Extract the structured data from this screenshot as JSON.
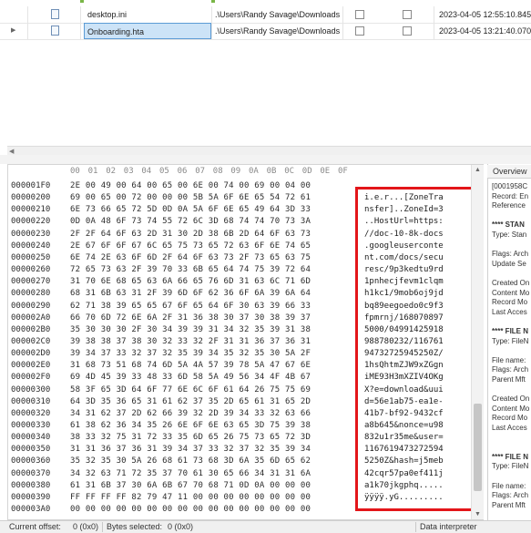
{
  "file_grid": {
    "rows": [
      {
        "name": "desktop.ini",
        "path": ".\\Users\\Randy Savage\\Downloads",
        "date": "2023-04-05 12:55:10.845",
        "selected": false,
        "current": false
      },
      {
        "name": "Onboarding.hta",
        "path": ".\\Users\\Randy Savage\\Downloads",
        "date": "2023-04-05 13:21:40.070",
        "selected": true,
        "current": true
      }
    ]
  },
  "hex": {
    "header": [
      "00",
      "01",
      "02",
      "03",
      "04",
      "05",
      "06",
      "07",
      "08",
      "09",
      "0A",
      "0B",
      "0C",
      "0D",
      "0E",
      "0F"
    ],
    "rows": [
      {
        "offset": "000001F0",
        "bytes": "2E 00 49 00 64 00 65 00 6E 00 74 00 69 00 04 00",
        "ascii": ""
      },
      {
        "offset": "00000200",
        "bytes": "69 00 65 00 72 00 00 00 5B 5A 6F 6E 65 54 72 61",
        "ascii": "i.e.r...[ZoneTra"
      },
      {
        "offset": "00000210",
        "bytes": "6E 73 66 65 72 5D 0D 0A 5A 6F 6E 65 49 64 3D 33",
        "ascii": "nsfer]..ZoneId=3"
      },
      {
        "offset": "00000220",
        "bytes": "0D 0A 48 6F 73 74 55 72 6C 3D 68 74 74 70 73 3A",
        "ascii": "..HostUrl=https:"
      },
      {
        "offset": "00000230",
        "bytes": "2F 2F 64 6F 63 2D 31 30 2D 38 6B 2D 64 6F 63 73",
        "ascii": "//doc-10-8k-docs"
      },
      {
        "offset": "00000240",
        "bytes": "2E 67 6F 6F 67 6C 65 75 73 65 72 63 6F 6E 74 65",
        "ascii": ".googleuserconte"
      },
      {
        "offset": "00000250",
        "bytes": "6E 74 2E 63 6F 6D 2F 64 6F 63 73 2F 73 65 63 75",
        "ascii": "nt.com/docs/secu"
      },
      {
        "offset": "00000260",
        "bytes": "72 65 73 63 2F 39 70 33 6B 65 64 74 75 39 72 64",
        "ascii": "resc/9p3kedtu9rd"
      },
      {
        "offset": "00000270",
        "bytes": "31 70 6E 68 65 63 6A 66 65 76 6D 31 63 6C 71 6D",
        "ascii": "1pnhecjfevm1clqm"
      },
      {
        "offset": "00000280",
        "bytes": "68 31 6B 63 31 2F 39 6D 6F 62 36 6F 6A 39 6A 64",
        "ascii": "h1kc1/9mob6oj9jd"
      },
      {
        "offset": "00000290",
        "bytes": "62 71 38 39 65 65 67 6F 65 64 6F 30 63 39 66 33",
        "ascii": "bq89eegoedo0c9f3"
      },
      {
        "offset": "000002A0",
        "bytes": "66 70 6D 72 6E 6A 2F 31 36 38 30 37 30 38 39 37",
        "ascii": "fpmrnj/168070897"
      },
      {
        "offset": "000002B0",
        "bytes": "35 30 30 30 2F 30 34 39 39 31 34 32 35 39 31 38",
        "ascii": "5000/04991425918"
      },
      {
        "offset": "000002C0",
        "bytes": "39 38 38 37 38 30 32 33 32 2F 31 31 36 37 36 31",
        "ascii": "988780232/116761"
      },
      {
        "offset": "000002D0",
        "bytes": "39 34 37 33 32 37 32 35 39 34 35 32 35 30 5A 2F",
        "ascii": "94732725945250Z/"
      },
      {
        "offset": "000002E0",
        "bytes": "31 68 73 51 68 74 6D 5A 4A 57 39 78 5A 47 67 6E",
        "ascii": "1hsQhtmZJW9xZGgn"
      },
      {
        "offset": "000002F0",
        "bytes": "69 4D 45 39 33 48 33 6D 58 5A 49 56 34 4F 4B 67",
        "ascii": "iME93H3mXZIV4OKg"
      },
      {
        "offset": "00000300",
        "bytes": "58 3F 65 3D 64 6F 77 6E 6C 6F 61 64 26 75 75 69",
        "ascii": "X?e=download&uui"
      },
      {
        "offset": "00000310",
        "bytes": "64 3D 35 36 65 31 61 62 37 35 2D 65 61 31 65 2D",
        "ascii": "d=56e1ab75-ea1e-"
      },
      {
        "offset": "00000320",
        "bytes": "34 31 62 37 2D 62 66 39 32 2D 39 34 33 32 63 66",
        "ascii": "41b7-bf92-9432cf"
      },
      {
        "offset": "00000330",
        "bytes": "61 38 62 36 34 35 26 6E 6F 6E 63 65 3D 75 39 38",
        "ascii": "a8b645&nonce=u98"
      },
      {
        "offset": "00000340",
        "bytes": "38 33 32 75 31 72 33 35 6D 65 26 75 73 65 72 3D",
        "ascii": "832u1r35me&user="
      },
      {
        "offset": "00000350",
        "bytes": "31 31 36 37 36 31 39 34 37 33 32 37 32 35 39 34",
        "ascii": "1167619473272594"
      },
      {
        "offset": "00000360",
        "bytes": "35 32 35 30 5A 26 68 61 73 68 3D 6A 35 6D 65 62",
        "ascii": "5250Z&hash=j5meb"
      },
      {
        "offset": "00000370",
        "bytes": "34 32 63 71 72 35 37 70 61 30 65 66 34 31 31 6A",
        "ascii": "42cqr57pa0ef411j"
      },
      {
        "offset": "00000380",
        "bytes": "61 31 6B 37 30 6A 6B 67 70 68 71 0D 0A 00 00 00",
        "ascii": "a1k70jkgphq....."
      },
      {
        "offset": "00000390",
        "bytes": "FF FF FF FF 82 79 47 11 00 00 00 00 00 00 00 00",
        "ascii": "ÿÿÿÿ.yG........."
      },
      {
        "offset": "000003A0",
        "bytes": "00 00 00 00 00 00 00 00 00 00 00 00 00 00 00 00",
        "ascii": "................"
      }
    ]
  },
  "side_panel": {
    "tab": "Overview",
    "lines": [
      {
        "text": "[0001958C",
        "bold": false
      },
      {
        "text": "Record: En",
        "bold": false
      },
      {
        "text": "Reference",
        "bold": false
      },
      {
        "text": "",
        "bold": false
      },
      {
        "text": "**** STAN",
        "bold": true
      },
      {
        "text": "Type: Stan",
        "bold": false
      },
      {
        "text": "",
        "bold": false
      },
      {
        "text": "Flags: Arch",
        "bold": false
      },
      {
        "text": "Update Se",
        "bold": false
      },
      {
        "text": "",
        "bold": false
      },
      {
        "text": "Created On",
        "bold": false
      },
      {
        "text": "Content Mo",
        "bold": false
      },
      {
        "text": "Record Mo",
        "bold": false
      },
      {
        "text": "Last Acces",
        "bold": false
      },
      {
        "text": "",
        "bold": false
      },
      {
        "text": "**** FILE N",
        "bold": true
      },
      {
        "text": "Type: FileN",
        "bold": false
      },
      {
        "text": "",
        "bold": false
      },
      {
        "text": "File name:",
        "bold": false
      },
      {
        "text": "Flags: Arch",
        "bold": false
      },
      {
        "text": "Parent Mft",
        "bold": false
      },
      {
        "text": "",
        "bold": false
      },
      {
        "text": "Created On",
        "bold": false
      },
      {
        "text": "Content Mo",
        "bold": false
      },
      {
        "text": "Record Mo",
        "bold": false
      },
      {
        "text": "Last Acces",
        "bold": false
      },
      {
        "text": "",
        "bold": false
      },
      {
        "text": "",
        "bold": false
      },
      {
        "text": "**** FILE N",
        "bold": true
      },
      {
        "text": "Type: FileN",
        "bold": false
      },
      {
        "text": "",
        "bold": false
      },
      {
        "text": "File name:",
        "bold": false
      },
      {
        "text": "Flags: Arch",
        "bold": false
      },
      {
        "text": "Parent Mft",
        "bold": false
      },
      {
        "text": "",
        "bold": false
      },
      {
        "text": "Created On",
        "bold": false
      }
    ]
  },
  "status_bar": {
    "offset_label": "Current offset:",
    "offset_value": "0 (0x0)",
    "selected_label": "Bytes selected:",
    "selected_value": "0 (0x0)",
    "interpreter": "Data interpreter"
  },
  "colors": {
    "highlight_box": "#e3161a",
    "selection": "#cce3f7",
    "selection_border": "#5b9bd5"
  }
}
